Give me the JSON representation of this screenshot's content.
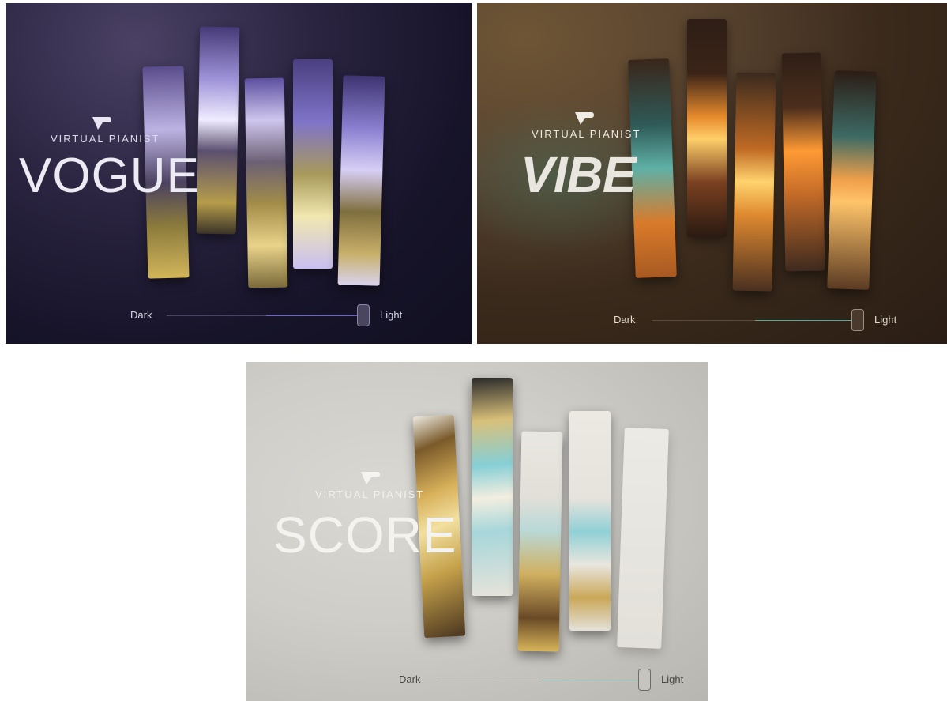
{
  "panels": {
    "vogue": {
      "brand": "VIRTUAL PIANIST",
      "product": "VOGUE",
      "slider": {
        "left_label": "Dark",
        "right_label": "Light",
        "value": 0.97
      },
      "accent": "#6a63d6"
    },
    "vibe": {
      "brand": "VIRTUAL PIANIST",
      "product": "VIBE",
      "slider": {
        "left_label": "Dark",
        "right_label": "Light",
        "value": 0.97
      },
      "accent": "#5fa394"
    },
    "score": {
      "brand": "VIRTUAL PIANIST",
      "product": "SCORE",
      "slider": {
        "left_label": "Dark",
        "right_label": "Light",
        "value": 0.97
      },
      "accent": "#5a9a90"
    }
  },
  "icons": {
    "logo": "virtual-pianist-logo-icon"
  }
}
